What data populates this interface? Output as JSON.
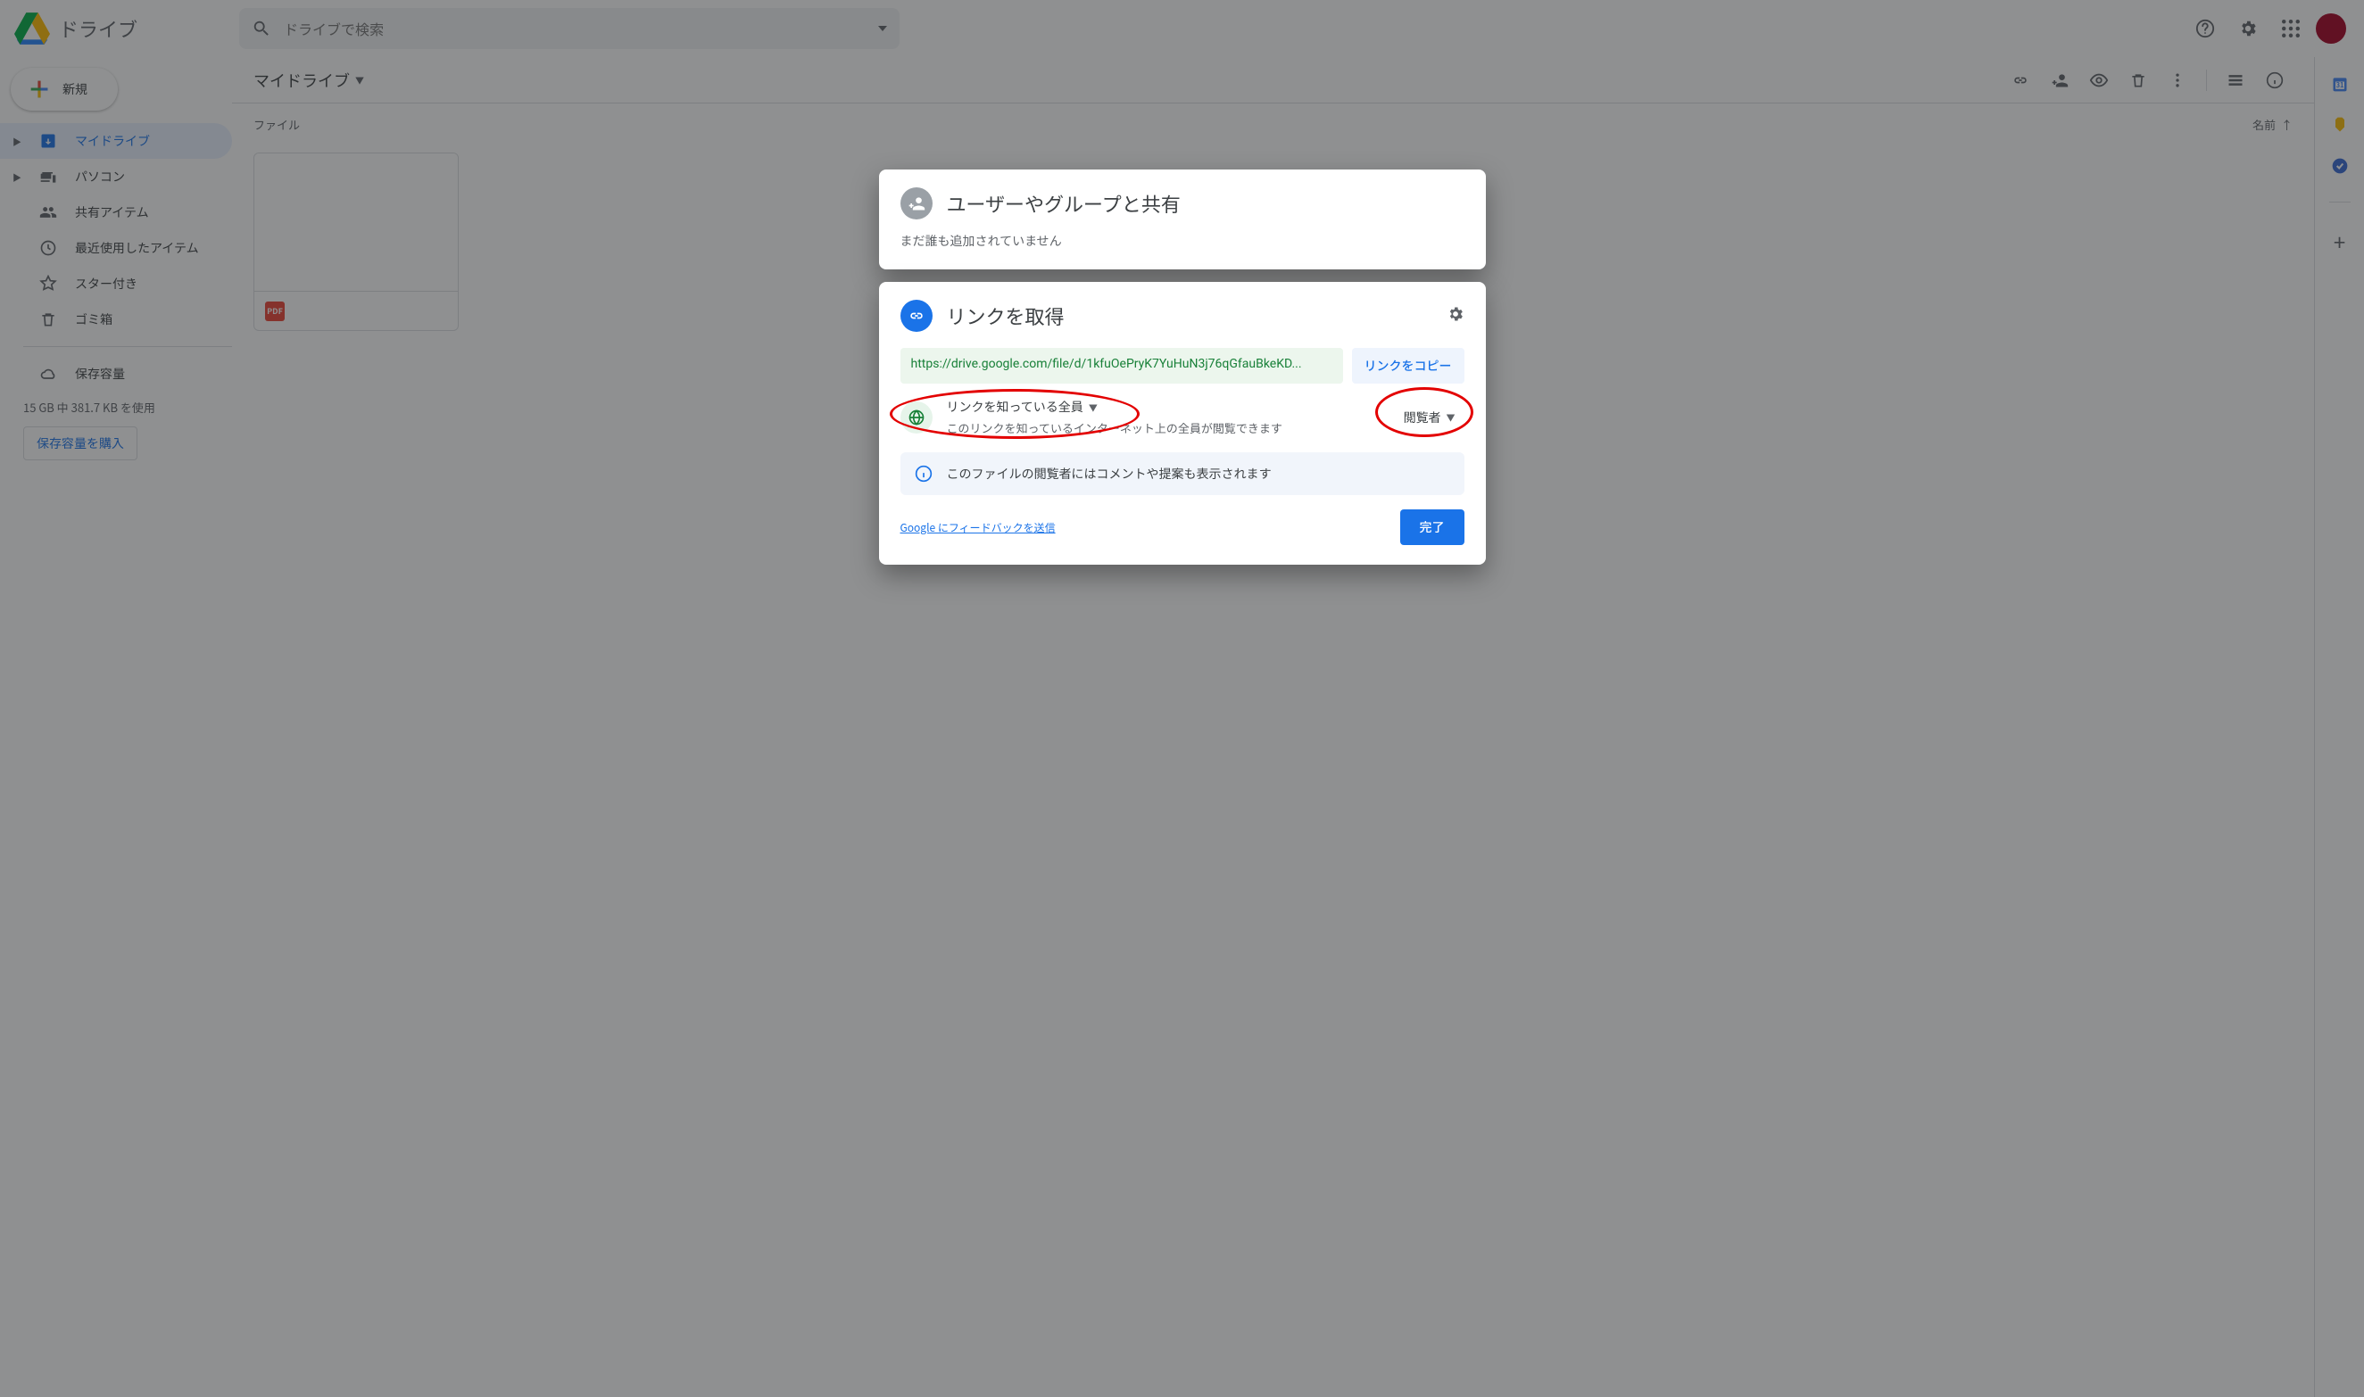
{
  "header": {
    "appName": "ドライブ",
    "searchPlaceholder": "ドライブで検索"
  },
  "sidebar": {
    "newLabel": "新規",
    "items": [
      {
        "label": "マイドライブ",
        "active": true,
        "expandable": true
      },
      {
        "label": "パソコン",
        "active": false,
        "expandable": true
      },
      {
        "label": "共有アイテム",
        "active": false
      },
      {
        "label": "最近使用したアイテム",
        "active": false
      },
      {
        "label": "スター付き",
        "active": false
      },
      {
        "label": "ゴミ箱",
        "active": false
      }
    ],
    "storageLabel": "保存容量",
    "storageText": "15 GB 中 381.7 KB を使用",
    "buyLabel": "保存容量を購入"
  },
  "main": {
    "breadcrumb": "マイドライブ",
    "filesHeading": "ファイル",
    "sortLabel": "名前",
    "fileBadge": "PDF"
  },
  "dialog": {
    "share": {
      "title": "ユーザーやグループと共有",
      "subtitle": "まだ誰も追加されていません"
    },
    "link": {
      "title": "リンクを取得",
      "url": "https://drive.google.com/file/d/1kfuOePryK7YuHuN3j76qGfauBkeKD...",
      "copyLabel": "リンクをコピー",
      "accessMain": "リンクを知っている全員",
      "accessSub": "このリンクを知っているインターネット上の全員が閲覧できます",
      "roleLabel": "閲覧者",
      "infoText": "このファイルの閲覧者にはコメントや提案も表示されます",
      "feedback": "Google にフィードバックを送信",
      "done": "完了"
    }
  }
}
